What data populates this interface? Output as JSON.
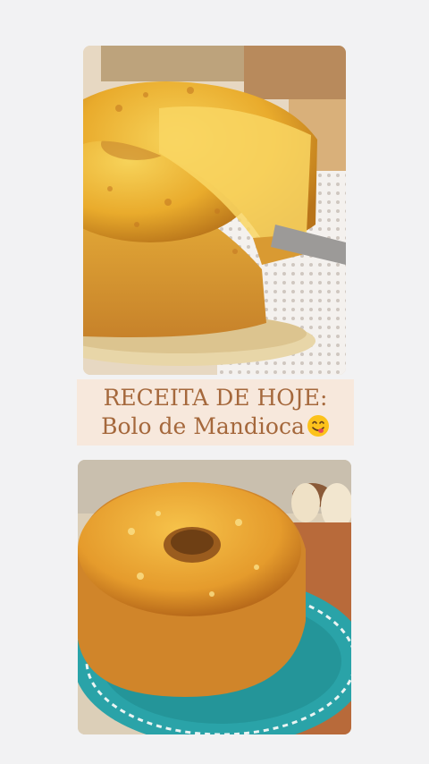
{
  "post": {
    "title_line1": "RECEITA DE HOJE:",
    "title_line2": "Bolo de Mandioca",
    "emoji": "yummy-face-emoji"
  },
  "images": {
    "top": "cassava-cake-slice-photo",
    "bottom": "cassava-cake-on-teal-plate-photo"
  },
  "colors": {
    "background": "#f2f2f3",
    "caption_bg": "#f7e8dc",
    "caption_text": "#a5683c",
    "plate_teal": "#2aa3a8"
  }
}
